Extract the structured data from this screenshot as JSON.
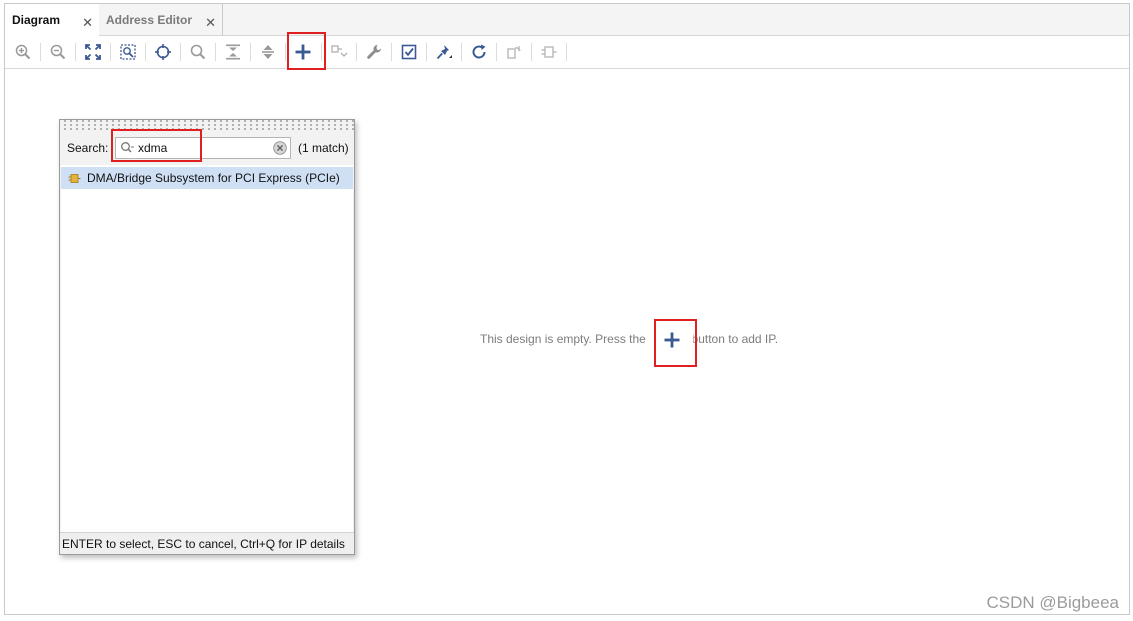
{
  "tabs": [
    {
      "label": "Diagram",
      "active": true
    },
    {
      "label": "Address Editor",
      "active": false
    }
  ],
  "toolbar": {
    "buttons": [
      "zoom-in-icon",
      "zoom-out-icon",
      "zoom-fit-icon",
      "zoom-area-icon",
      "center-icon",
      "search-icon",
      "collapse-icon",
      "expand-icon",
      "add-ip-icon",
      "make-connection-icon",
      "properties-wrench-icon",
      "validate-design-icon",
      "pin-icon",
      "refresh-icon",
      "regenerate-layout-icon",
      "port-icon"
    ]
  },
  "canvas": {
    "empty_message_before": "This design is empty. Press the",
    "empty_message_after": "button to add IP."
  },
  "ip_search": {
    "label": "Search:",
    "value": "xdma",
    "match_count": "(1 match)",
    "results": [
      {
        "label": "DMA/Bridge Subsystem for PCI Express (PCIe)"
      }
    ],
    "footer": "ENTER to select, ESC to cancel, Ctrl+Q for IP details"
  },
  "watermark": "CSDN @Bigbeea",
  "colors": {
    "accent": "#3b5a94",
    "highlight": "#e02020",
    "selection": "#cfe0f5"
  }
}
